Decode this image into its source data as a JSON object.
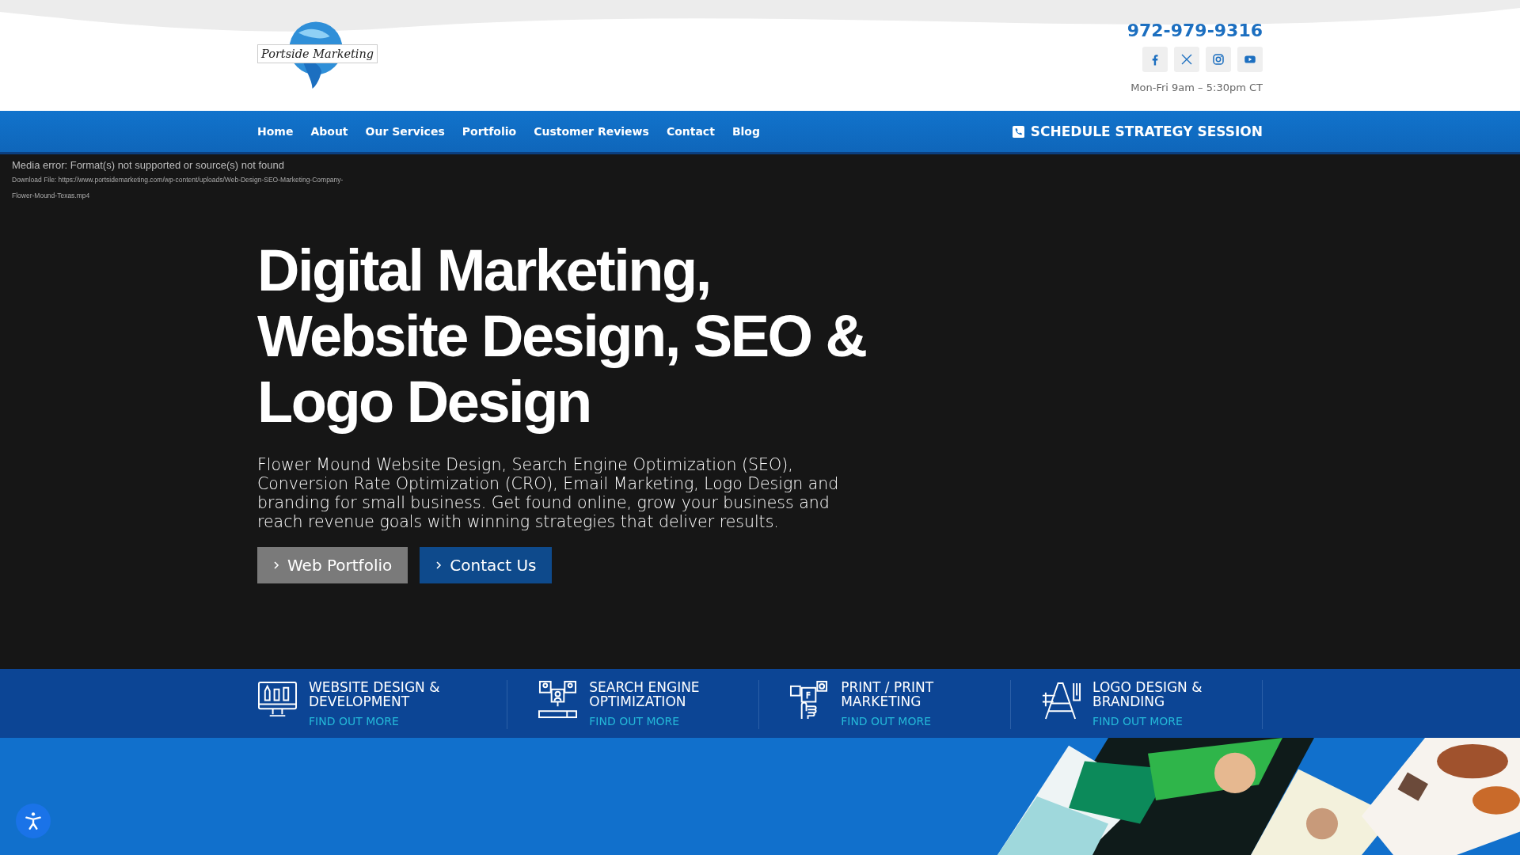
{
  "header": {
    "logo_text": "Portside Marketing",
    "phone": "972-979-9316",
    "social": [
      {
        "kind": "facebook"
      },
      {
        "kind": "x"
      },
      {
        "kind": "instagram"
      },
      {
        "kind": "youtube"
      }
    ],
    "hours": "Mon-Fri 9am – 5:30pm CT"
  },
  "nav": {
    "items": [
      "Home",
      "About",
      "Our Services",
      "Portfolio",
      "Customer Reviews",
      "Contact",
      "Blog"
    ],
    "cta": "SCHEDULE STRATEGY SESSION"
  },
  "media_error": {
    "message": "Media error: Format(s) not supported or source(s) not found",
    "download_lines": [
      "Download File: https://www.portsidemarketing.com/wp-content/uploads/Web-Design-SEO-Marketing-Company-",
      "Flower-Mound-Texas.mp4"
    ]
  },
  "hero": {
    "title": "Digital Marketing, Website Design, SEO & Logo Design",
    "description": "Flower Mound Website Design, Search Engine Optimization (SEO), Conversion Rate Optimization (CRO), Email Marketing, Logo Design and branding for small business. Get found online, grow your business and reach revenue goals with winning strategies that deliver results.",
    "buttons": [
      {
        "label": "Web Portfolio",
        "kind": "secondary"
      },
      {
        "label": "Contact Us",
        "kind": "primary"
      }
    ]
  },
  "services": [
    {
      "kind": "web",
      "title": "WEBSITE DESIGN & DEVELOPMENT",
      "link": "FIND OUT MORE"
    },
    {
      "kind": "seo",
      "title": "SEARCH ENGINE OPTIMIZATION",
      "link": "FIND OUT MORE"
    },
    {
      "kind": "print",
      "title": "PRINT / PRINT MARKETING",
      "link": "FIND OUT MORE"
    },
    {
      "kind": "logo",
      "title": "LOGO DESIGN & BRANDING",
      "link": "FIND OUT MORE"
    }
  ]
}
